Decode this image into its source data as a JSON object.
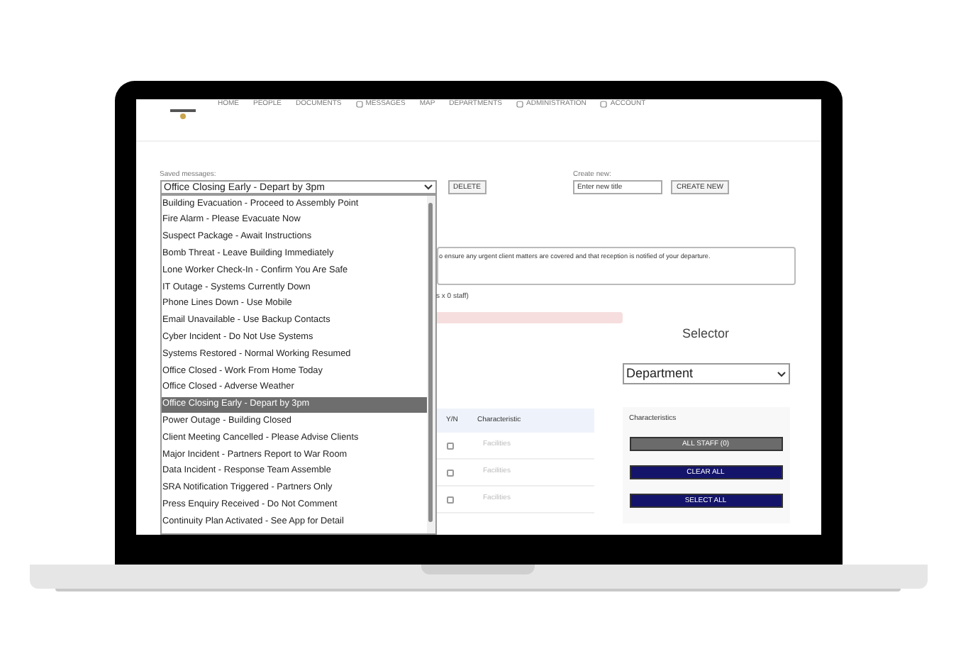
{
  "nav": [
    {
      "label": "HOME",
      "icon": false
    },
    {
      "label": "PEOPLE",
      "icon": false
    },
    {
      "label": "DOCUMENTS",
      "icon": false
    },
    {
      "label": "MESSAGES",
      "icon": true
    },
    {
      "label": "MAP",
      "icon": false
    },
    {
      "label": "DEPARTMENTS",
      "icon": false
    },
    {
      "label": "ADMINISTRATION",
      "icon": true
    },
    {
      "label": "ACCOUNT",
      "icon": true
    }
  ],
  "saved_messages": {
    "label": "Saved messages:",
    "value": "Office Closing Early - Depart by 3pm",
    "delete": "DELETE",
    "options": [
      {
        "label": "Building Evacuation - Proceed to Assembly Point",
        "selected": false
      },
      {
        "label": "Fire Alarm - Please Evacuate Now",
        "selected": false
      },
      {
        "label": "Suspect Package - Await Instructions",
        "selected": false
      },
      {
        "label": "Bomb Threat - Leave Building Immediately",
        "selected": false
      },
      {
        "label": "Lone Worker Check-In - Confirm You Are Safe",
        "selected": false
      },
      {
        "label": "IT Outage - Systems Currently Down",
        "selected": false
      },
      {
        "label": "Phone Lines Down - Use Mobile",
        "selected": false
      },
      {
        "label": "Email Unavailable - Use Backup Contacts",
        "selected": false
      },
      {
        "label": "Cyber Incident - Do Not Use Systems",
        "selected": false
      },
      {
        "label": "Systems Restored - Normal Working Resumed",
        "selected": false
      },
      {
        "label": "Office Closed - Work From Home Today",
        "selected": false
      },
      {
        "label": "Office Closed - Adverse Weather",
        "selected": false
      },
      {
        "label": "Office Closing Early - Depart by 3pm",
        "selected": true
      },
      {
        "label": "Power Outage - Building Closed",
        "selected": false
      },
      {
        "label": "Client Meeting Cancelled - Please Advise Clients",
        "selected": false
      },
      {
        "label": "Major Incident - Partners Report to War Room",
        "selected": false
      },
      {
        "label": "Data Incident - Response Team Assemble",
        "selected": false
      },
      {
        "label": "SRA Notification Triggered - Partners Only",
        "selected": false
      },
      {
        "label": "Press Enquiry Received - Do Not Comment",
        "selected": false
      },
      {
        "label": "Continuity Plan Activated - See App for Detail",
        "selected": false
      }
    ]
  },
  "create_new": {
    "label": "Create new:",
    "placeholder": "Enter new title",
    "button": "CREATE NEW"
  },
  "message_text": "o ensure any urgent client matters are covered and that reception is notified of your departure.",
  "staff_count": "s x 0 staff)",
  "table": {
    "columns": [
      "Y/N",
      "Characteristic"
    ],
    "rows": [
      {
        "checked": false,
        "characteristic": "Facilities"
      },
      {
        "checked": false,
        "characteristic": "Facilities"
      },
      {
        "checked": false,
        "characteristic": "Facilities"
      }
    ]
  },
  "selector": {
    "title": "Selector",
    "value": "Department",
    "panel_title": "Characteristics",
    "buttons": [
      {
        "label": "ALL STAFF (0)",
        "kind": "count"
      },
      {
        "label": "CLEAR ALL",
        "kind": "action"
      },
      {
        "label": "SELECT ALL",
        "kind": "action"
      }
    ]
  }
}
